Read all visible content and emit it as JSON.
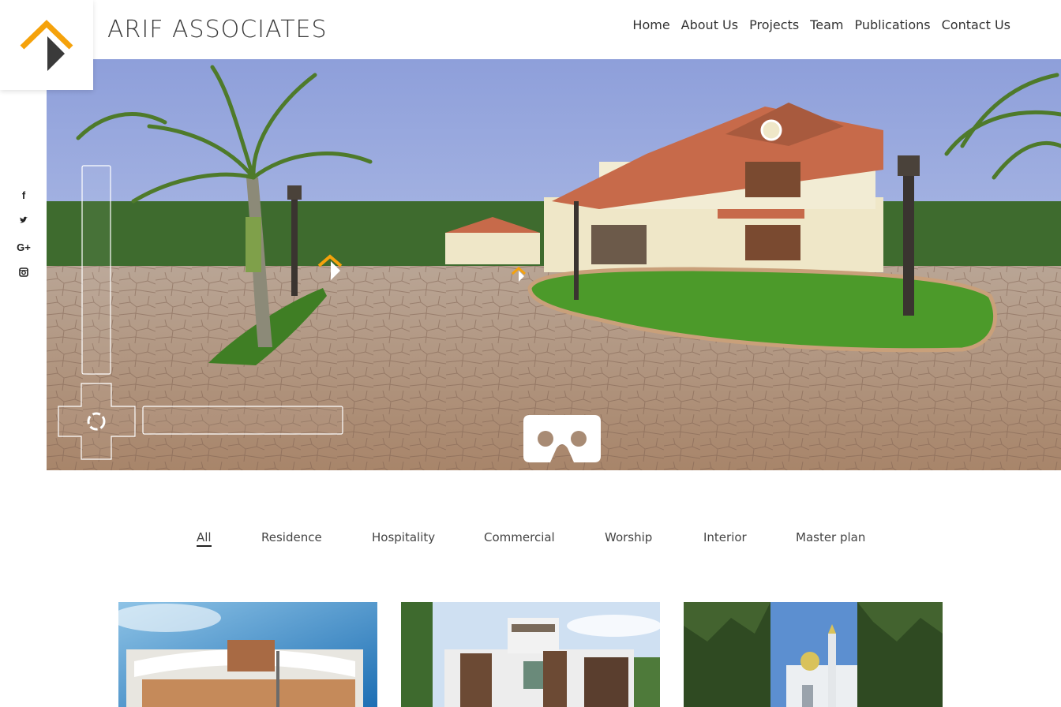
{
  "brand": {
    "name": "ARIF ASSOCIATES",
    "logo_icon": "arrow-house-logo-icon",
    "accent": "#F5A20B"
  },
  "nav": {
    "items": [
      {
        "label": "Home"
      },
      {
        "label": "About Us"
      },
      {
        "label": "Projects"
      },
      {
        "label": "Team"
      },
      {
        "label": "Publications"
      },
      {
        "label": "Contact Us"
      }
    ]
  },
  "social": {
    "items": [
      {
        "icon": "facebook-icon",
        "glyph": "f"
      },
      {
        "icon": "twitter-icon",
        "glyph": "t"
      },
      {
        "icon": "google-plus-icon",
        "glyph": "G+"
      },
      {
        "icon": "instagram-icon",
        "glyph": "◙"
      }
    ]
  },
  "panorama": {
    "vr_icon": "vr-headset-icon",
    "hotspot_icon": "hotspot-arrow-icon",
    "colors": {
      "sky": "#A9B7E6",
      "paving": "#B8967A",
      "grass": "#4C9A2A",
      "house": "#EFE7C8",
      "roof": "#C76A4A"
    }
  },
  "filters": {
    "tabs": [
      {
        "label": "All",
        "active": true
      },
      {
        "label": "Residence",
        "active": false
      },
      {
        "label": "Hospitality",
        "active": false
      },
      {
        "label": "Commercial",
        "active": false
      },
      {
        "label": "Worship",
        "active": false
      },
      {
        "label": "Interior",
        "active": false
      },
      {
        "label": "Master plan",
        "active": false
      }
    ]
  },
  "projects": [
    {
      "kind": "commercial-building-thumbnail"
    },
    {
      "kind": "residence-thumbnail"
    },
    {
      "kind": "mosque-thumbnail"
    }
  ]
}
